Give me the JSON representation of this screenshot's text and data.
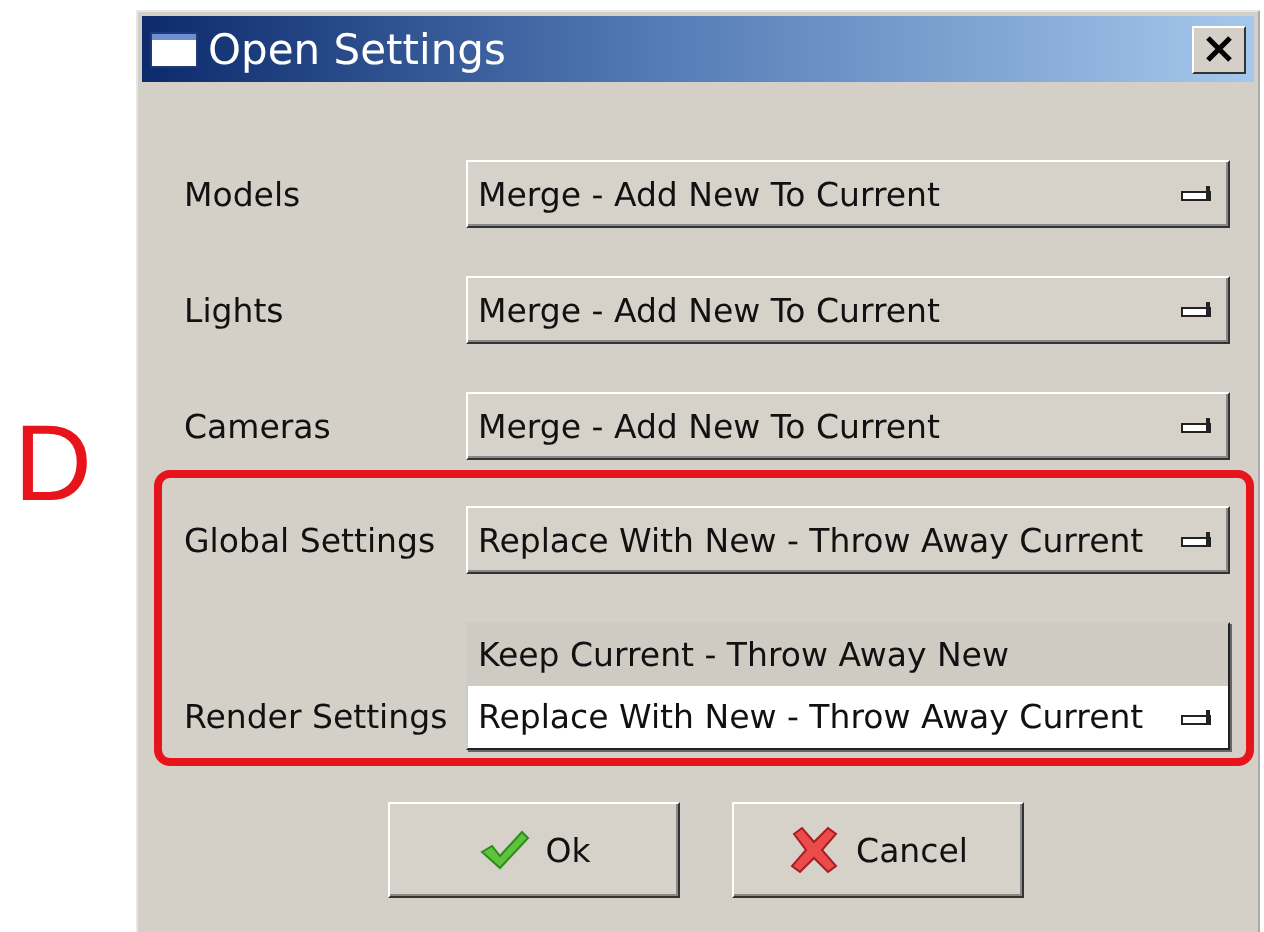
{
  "annotation": {
    "letter": "D"
  },
  "window": {
    "title": "Open Settings"
  },
  "rows": [
    {
      "label": "Models",
      "value": "Merge - Add New To Current",
      "highlighted": false,
      "expanded": false
    },
    {
      "label": "Lights",
      "value": "Merge - Add New To Current",
      "highlighted": false,
      "expanded": false
    },
    {
      "label": "Cameras",
      "value": "Merge - Add New To Current",
      "highlighted": false,
      "expanded": false
    },
    {
      "label": "Global Settings",
      "value": "Replace With New - Throw Away Current",
      "highlighted": true,
      "expanded": false
    },
    {
      "label": "Render Settings",
      "value": "Replace With New - Throw Away Current",
      "highlighted": true,
      "expanded": true,
      "options": [
        "Keep Current - Throw Away New"
      ]
    }
  ],
  "buttons": [
    {
      "label": "Ok",
      "kind": "ok"
    },
    {
      "label": "Cancel",
      "kind": "cancel"
    }
  ]
}
